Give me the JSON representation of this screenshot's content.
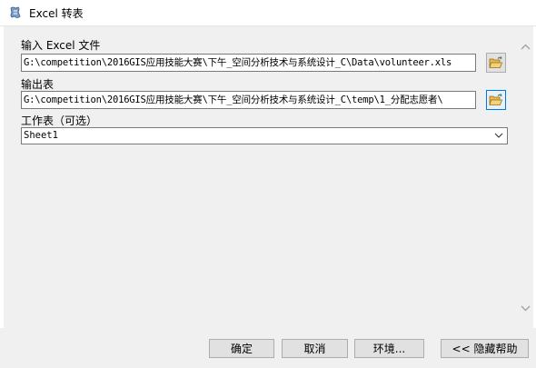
{
  "window": {
    "title": "Excel 转表",
    "icon": "arcgis-tool-icon"
  },
  "form": {
    "input_label": "输入 Excel 文件",
    "input_value": "G:\\competition\\2016GIS应用技能大赛\\下午_空间分析技术与系统设计_C\\Data\\volunteer.xls",
    "output_label": "输出表",
    "output_value": "G:\\competition\\2016GIS应用技能大赛\\下午_空间分析技术与系统设计_C\\temp\\1_分配志愿者\\",
    "sheet_label": "工作表（可选）",
    "sheet_value": "Sheet1"
  },
  "buttons": {
    "ok": "确定",
    "cancel": "取消",
    "environments": "环境...",
    "hide_help": "<< 隐藏帮助"
  },
  "colors": {
    "panel_bg": "#f0f0f0",
    "active_border": "#0078d7",
    "folder_yellow": "#e8b84a"
  }
}
